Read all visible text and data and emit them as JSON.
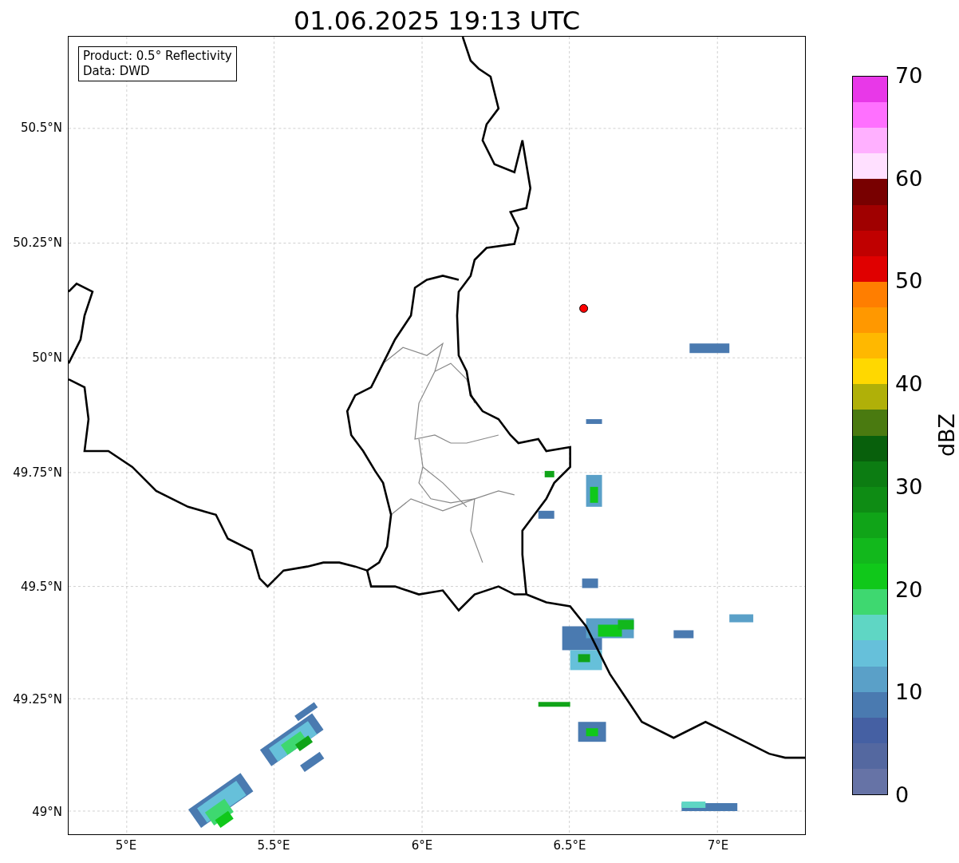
{
  "title": "01.06.2025 19:13 UTC",
  "legend": [
    "Product: 0.5° Reflectivity",
    "Data: DWD"
  ],
  "yticks": [
    "50.5°N",
    "50.25°N",
    "50°N",
    "49.75°N",
    "49.5°N",
    "49.25°N",
    "49°N"
  ],
  "xticks": [
    "5°E",
    "5.5°E",
    "6°E",
    "6.5°E",
    "7°E"
  ],
  "colorbar": {
    "label": "dBZ",
    "ticks": [
      "70",
      "60",
      "50",
      "40",
      "30",
      "20",
      "10",
      "0"
    ],
    "segments": [
      {
        "color": "#e838e8"
      },
      {
        "color": "#ff70ff"
      },
      {
        "color": "#ffb0ff"
      },
      {
        "color": "#ffe0ff"
      },
      {
        "color": "#780000"
      },
      {
        "color": "#a00000"
      },
      {
        "color": "#c00000"
      },
      {
        "color": "#e00000"
      },
      {
        "color": "#ff7e00"
      },
      {
        "color": "#ff9800"
      },
      {
        "color": "#ffb800"
      },
      {
        "color": "#ffd800"
      },
      {
        "color": "#b0b008"
      },
      {
        "color": "#4a7a10"
      },
      {
        "color": "#08600c"
      },
      {
        "color": "#0c7c12"
      },
      {
        "color": "#0e8c14"
      },
      {
        "color": "#10a418"
      },
      {
        "color": "#12b81c"
      },
      {
        "color": "#10c81a"
      },
      {
        "color": "#3ed870"
      },
      {
        "color": "#5fd6c4"
      },
      {
        "color": "#66c0da"
      },
      {
        "color": "#5aa0c8"
      },
      {
        "color": "#4a7ab0"
      },
      {
        "color": "#4560a3"
      },
      {
        "color": "#5468a0"
      },
      {
        "color": "#6673a6"
      }
    ]
  }
}
